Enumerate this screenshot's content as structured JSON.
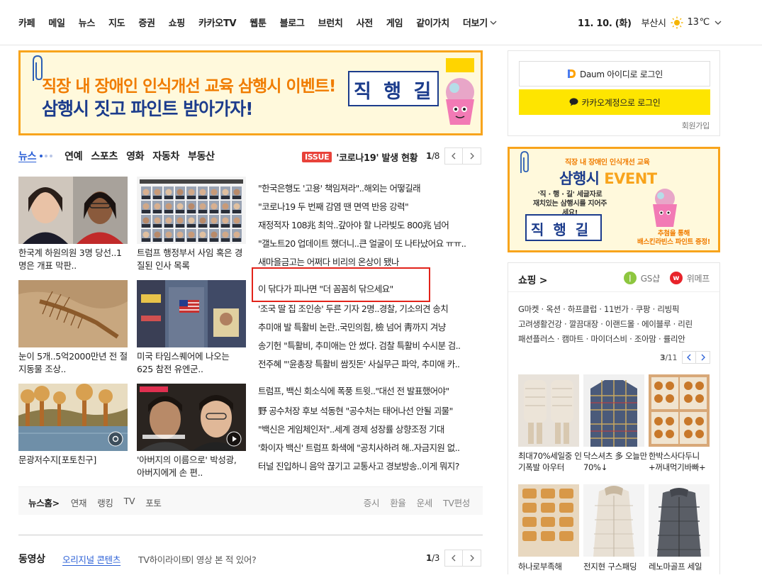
{
  "topnav": {
    "items": [
      "카페",
      "메일",
      "뉴스",
      "지도",
      "증권",
      "쇼핑",
      "카카오TV",
      "웹툰",
      "블로그",
      "브런치",
      "사전",
      "게임",
      "같이가치",
      "더보기"
    ],
    "date": "11. 10. (화)",
    "city": "부산시",
    "temp": "13",
    "temp_unit": "℃",
    "weather_icon": "sun-icon"
  },
  "main_banner": {
    "line1": "직장 내 장애인 인식개선 교육 삼행시 이벤트!",
    "line2": "삼행시 짓고 파인트 받아가자!",
    "badge": "직 행 길"
  },
  "news": {
    "tabs": [
      "뉴스",
      "연예",
      "스포츠",
      "영화",
      "자동차",
      "부동산"
    ],
    "issue_badge": "ISSUE",
    "issue_text": "'코로나19' 발생 현황",
    "page_current": "1",
    "page_total": "/8",
    "thumbs": [
      {
        "caption": "한국계 하원의원 3명 당선..1명은 개표 막판.."
      },
      {
        "caption": "트럼프 행정부서 사임 혹은 경질된 인사 목록"
      },
      {
        "caption": "눈이 5개..5억2000만년 전 절지동물 조상.."
      },
      {
        "caption": "미국 타임스퀘어에 나오는 625 참전 유엔군.."
      },
      {
        "caption": "문광저수지[포토친구]"
      },
      {
        "caption": "'아버지의 이름으로' 박성광, 아버지에게 손 편.."
      }
    ],
    "headlines": [
      "\"한국은행도 '고용' 책임져라\"..해외는 어떻길래",
      "\"코로나19 두 번째 감염 땐 면역 반응 강력\"",
      "재정적자 108兆 최악..갚아야 할 나라빚도 800兆 넘어",
      "\"갤노트20 업데이트 했더니..큰 얼굴이 또 나타났어요 ㅠㅠ..",
      "새마을금고는 어쩌다 비리의 온상이 됐나",
      "이 닦다가 피나면 \"더 꼼꼼히 닦으세요\"",
      "'조국 딸 집 조인송' 두른 기자 2명..경찰, 기소의견 송치",
      "추미애 발 특활비 논란..국민의힘, 檢 넘어 靑까지 겨냥",
      "송기헌 \"특활비, 추미애는 안 썼다. 검찰 특활비 수시분 검..",
      "전주혜 \"'윤총장 특활비 쌈짓돈' 사실무근 파악, 추미애 카..",
      "트럼프, 백신 회소식에 폭풍 트윗..\"대선 전 발표했어야\"",
      "野 공수처장 후보 석동현 \"공수처는 태어나선 안될 괴물\"",
      "\"백신은 게임체인저\"..세계 경제 성장률 상향조정 기대",
      "'화이자 백신' 트럼프 화색에 \"공치사하려 해..자금지원 없..",
      "터널 진입하니 음악 끊기고 교통사고 경보방송..이게 뭐지?"
    ],
    "footer_left": [
      "뉴스홈",
      "연재",
      "랭킹",
      "TV",
      "포토"
    ],
    "footer_right": [
      "증시",
      "환율",
      "운세",
      "TV편성"
    ]
  },
  "video": {
    "title": "동영상",
    "tabs": [
      "오리지널 콘텐츠",
      "TV하이라이트",
      "이 영상 본 적 있어?"
    ],
    "page_current": "1",
    "page_total": "/3"
  },
  "login": {
    "daum_label": "Daum 아이디로 로그인",
    "kakao_label": "카카오계정으로 로그인",
    "signup": "회원가입"
  },
  "side_banner": {
    "line1": "직장 내 장애인 인식개선 교육",
    "line2a": "삼행시 ",
    "line2b": "EVENT",
    "line3a": "'직 · 행 · 길' 세글자로",
    "line3b": "재치있는 삼행시를 지어주세요!",
    "badge": "직 행 길",
    "line4a": "추첨을 통해",
    "line4b": "배스킨라빈스 파인트 증정!"
  },
  "shop": {
    "title": "쇼핑",
    "partner1": "GS샵",
    "partner2": "위메프",
    "links": [
      "G마켓 · 옥션 · 하프클럽 · 11번가 · 쿠팡 · 리빙픽",
      "고려생활건강 · 깔끔대장 · 이랜드몰 · 에이블루 · 리린",
      "패션플러스 · 캠마트 · 마이더스비 · 조아맘 · 률리안"
    ],
    "page_current": "3",
    "page_total": "/11",
    "products": [
      {
        "caption": "최대70%세일중 인기폭발 아우터"
      },
      {
        "caption": "닥스셔츠 多 오늘만 70%↓"
      },
      {
        "caption": "한박스사다두니 +꺼내먹기바빠+"
      },
      {
        "caption": "하나로부족해"
      },
      {
        "caption": "전지현 구스패딩"
      },
      {
        "caption": "레노마골프 세일"
      }
    ]
  },
  "colors": {
    "accent_blue": "#2a5fd6",
    "banner_orange": "#f8a41c",
    "kakao_yellow": "#fee500",
    "highlight_red": "#e2231a"
  }
}
